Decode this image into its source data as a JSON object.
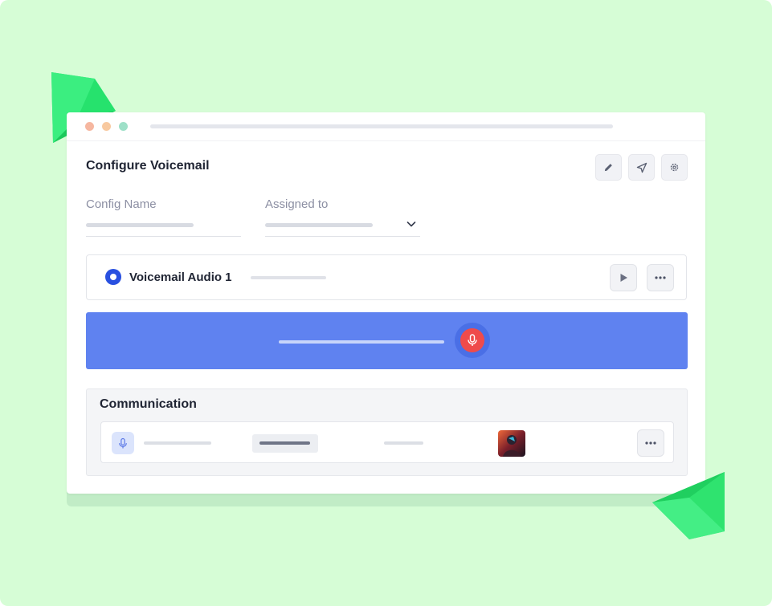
{
  "window": {
    "traffic_lights": [
      "#f6b7a0",
      "#f8c9a0",
      "#9ee0c8"
    ],
    "title": "Configure Voicemail",
    "toolbar_icons": [
      "pencil-icon",
      "send-icon",
      "gear-icon"
    ]
  },
  "form": {
    "config_name_label": "Config Name",
    "assigned_to_label": "Assigned to"
  },
  "audio": {
    "name": "Voicemail Audio 1",
    "selected": true
  },
  "recorder": {
    "icon": "microphone-icon"
  },
  "communication": {
    "title": "Communication"
  },
  "colors": {
    "background": "#d6fdd6",
    "accent": "#5f82f0",
    "record": "#ef4b4b",
    "radio": "#2950e0",
    "gem": "#22e06a"
  }
}
